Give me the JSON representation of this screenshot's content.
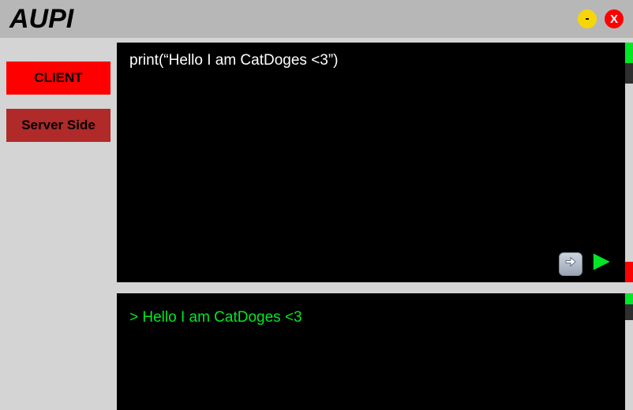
{
  "app": {
    "title": "AUPI"
  },
  "window": {
    "minimize_glyph": "-",
    "close_glyph": "X"
  },
  "sidebar": {
    "client_label": "CLIENT",
    "server_label": "Server Side"
  },
  "editor": {
    "code": "print(“Hello I am CatDoges <3”)"
  },
  "output": {
    "line": "> Hello I am CatDoges <3"
  },
  "colors": {
    "accent_green": "#00e826",
    "accent_red": "#ff0000",
    "accent_yellow": "#f5d60a"
  }
}
